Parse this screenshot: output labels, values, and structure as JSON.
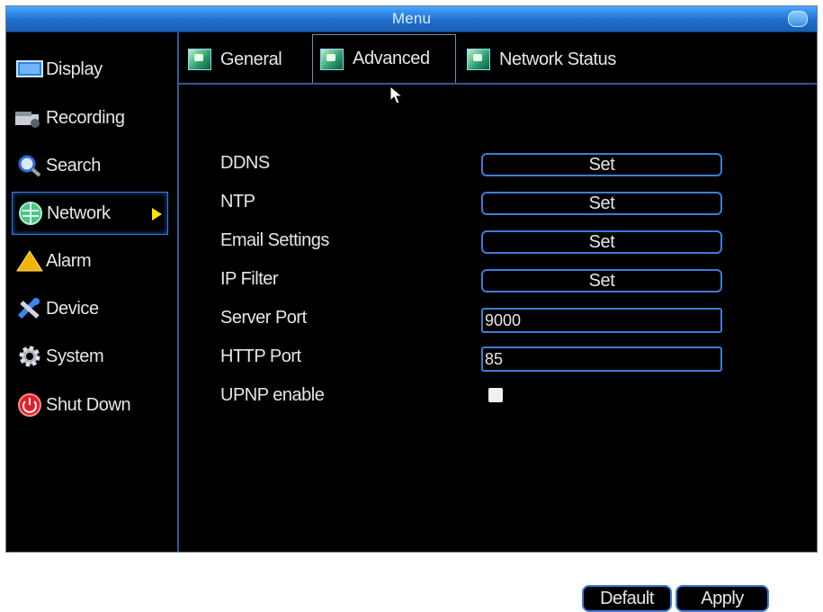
{
  "window": {
    "title": "Menu"
  },
  "sidebar": {
    "items": [
      {
        "label": "Display",
        "icon": "display-icon"
      },
      {
        "label": "Recording",
        "icon": "recorder-icon"
      },
      {
        "label": "Search",
        "icon": "magnifier-icon"
      },
      {
        "label": "Network",
        "icon": "globe-icon",
        "active": true
      },
      {
        "label": "Alarm",
        "icon": "warning-icon"
      },
      {
        "label": "Device",
        "icon": "tools-icon"
      },
      {
        "label": "System",
        "icon": "gear-icon"
      },
      {
        "label": "Shut Down",
        "icon": "power-icon"
      }
    ]
  },
  "tabs": [
    {
      "label": "General"
    },
    {
      "label": "Advanced",
      "active": true
    },
    {
      "label": "Network Status"
    }
  ],
  "advanced": {
    "ddns": {
      "label": "DDNS",
      "button": "Set"
    },
    "ntp": {
      "label": "NTP",
      "button": "Set"
    },
    "email": {
      "label": "Email Settings",
      "button": "Set"
    },
    "ipfilter": {
      "label": "IP Filter",
      "button": "Set"
    },
    "server_port": {
      "label": "Server Port",
      "value": "9000"
    },
    "http_port": {
      "label": "HTTP Port",
      "value": "85"
    },
    "upnp": {
      "label": "UPNP enable",
      "checked": false
    }
  },
  "footer": {
    "default_label": "Default",
    "apply_label": "Apply"
  },
  "colors": {
    "accent": "#3e7cd8",
    "titlebar": "#1e6fcf",
    "arrow": "#ffe400"
  }
}
